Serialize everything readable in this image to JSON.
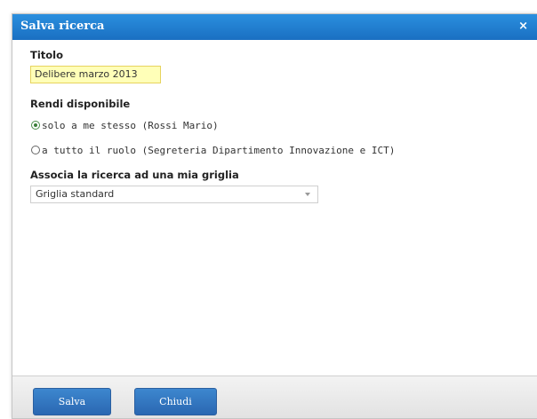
{
  "dialog": {
    "title": "Salva ricerca",
    "close_glyph": "×"
  },
  "form": {
    "title_label": "Titolo",
    "title_value": "Delibere marzo 2013",
    "availability_label": "Rendi disponibile",
    "options": [
      {
        "label": "solo a me stesso (Rossi Mario)",
        "checked": true
      },
      {
        "label": "a tutto il ruolo (Segreteria Dipartimento Innovazione e ICT)",
        "checked": false
      }
    ],
    "grid_label": "Associa la ricerca ad una mia griglia",
    "grid_selected": "Griglia standard"
  },
  "footer": {
    "save_label": "Salva",
    "close_label": "Chiudi"
  },
  "colors": {
    "titlebar": "#1e7ed0",
    "field_highlight": "#ffffb8",
    "button": "#3377c2"
  },
  "icons": {
    "close": "close-icon",
    "dropdown": "chevron-down-icon"
  }
}
